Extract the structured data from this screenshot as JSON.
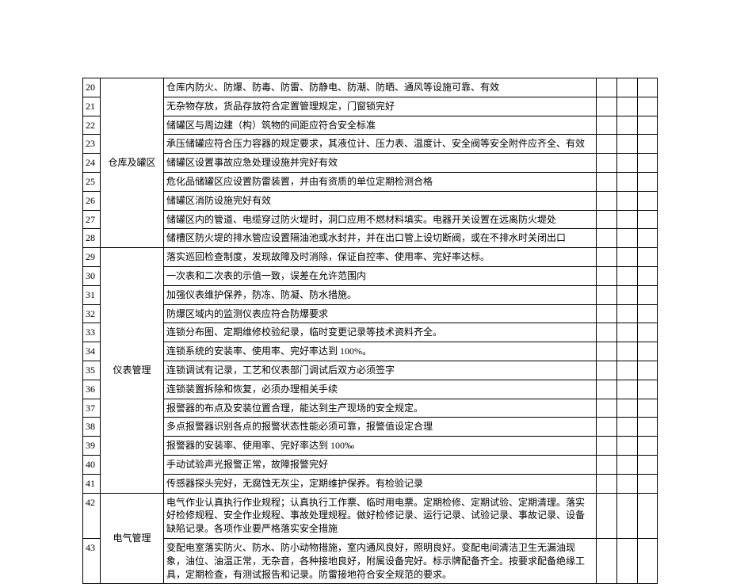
{
  "rows": [
    {
      "num": "20",
      "cat": "仓库及罐区",
      "cat_rows": 9,
      "desc": "仓库内防火、防爆、防毒、防雷、防静电、防潮、防晒、通风等设施可靠、有效"
    },
    {
      "num": "21",
      "desc": "无杂物存放，货品存放符合定置管理规定，门窗锁完好"
    },
    {
      "num": "22",
      "desc": "储罐区与周边建（构）筑物的间距应符合安全标准"
    },
    {
      "num": "23",
      "desc": "承压储罐应符合压力容器的规定要求，其液位计、压力表、温度计、安全阀等安全附件应齐全、有效"
    },
    {
      "num": "24",
      "desc": "储罐区设置事故应急处理设施并完好有效"
    },
    {
      "num": "25",
      "desc": "危化品储罐区应设置防雷装置，并由有资质的单位定期检测合格"
    },
    {
      "num": "26",
      "desc": "储罐区消防设施完好有效"
    },
    {
      "num": "27",
      "desc": "储罐区内的管道、电缆穿过防火堤时，洞口应用不燃材料填实。电器开关设置在远离防火堤处"
    },
    {
      "num": "28",
      "desc": "储槽区防火堤的排水管应设置隔油池或水封井，并在出口管上设切断阀，或在不排水时关闭出口"
    },
    {
      "num": "29",
      "cat": "仪表管理",
      "cat_rows": 13,
      "desc": "落实巡回检查制度，发现故障及时消除，保证自控率、使用率、完好率达标。"
    },
    {
      "num": "30",
      "desc": "一次表和二次表的示值一致，误差在允许范围内"
    },
    {
      "num": "31",
      "desc": "加强仪表维护保养，防冻、防凝、防水措施。"
    },
    {
      "num": "32",
      "desc": "防爆区域内的监测仪表应符合防爆要求"
    },
    {
      "num": "33",
      "desc": "连锁分布图、定期维修校验纪录，临时变更记录等技术资料齐全。"
    },
    {
      "num": "34",
      "desc": "连锁系统的安装率、使用率、完好率达到 100%。"
    },
    {
      "num": "35",
      "desc": "连锁调试有记录，工艺和仪表部门调试后双方必须签字"
    },
    {
      "num": "36",
      "desc": "连锁装置拆除和恢复，必须办理相关手续"
    },
    {
      "num": "37",
      "desc": "报警器的布点及安装位置合理，能达到生产现场的安全规定。"
    },
    {
      "num": "38",
      "desc": "多点报警器识别各点的报警状态性能必须可靠，报警值设定合理"
    },
    {
      "num": "39",
      "desc": "报警器的安装率、使用率、完好率达到 100‰"
    },
    {
      "num": "40",
      "desc": "手动试验声光报警正常，故障报警完好"
    },
    {
      "num": "41",
      "desc": "传感器探头完好，无腐蚀无灰尘，定期维护保养。有检验记录"
    },
    {
      "num": "42",
      "cat": "电气管理",
      "cat_rows": 2,
      "desc": "电气作业认真执行作业规程；认真执行工作票、临时用电票。定期检修、定期试验、定期清理。落实好检修规程、安全作业规程、事故处理规程。做好检修记录、运行记录、试验记录、事故记录、设备缺陷记录。各项作业要严格落实安全措施"
    },
    {
      "num": "43",
      "desc": "变配电室落实防火、防水、防小动物措施，室内通风良好，照明良好。变配电间清洁卫生无漏油现象，油位、油温正常，无杂音，各种接地良好，附属设备完好。标示牌配备齐全。按要求配备绝缘工具，定期检查，有测试报告和记录。防雷接地符合安全规范的要求。"
    }
  ]
}
